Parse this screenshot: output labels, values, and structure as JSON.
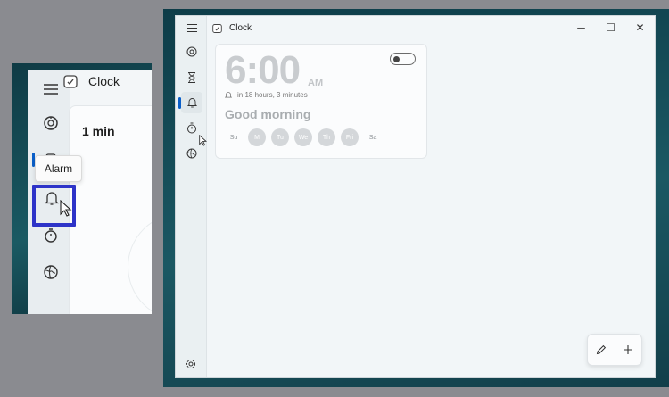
{
  "app": {
    "title": "Clock"
  },
  "inset": {
    "title": "Clock",
    "card_value": "1 min",
    "tooltip": "Alarm"
  },
  "window_controls": {
    "minimize": "─",
    "maximize": "☐",
    "close": "✕"
  },
  "nav": {
    "items": [
      {
        "id": "focus",
        "icon": "focus-sessions-icon"
      },
      {
        "id": "timer",
        "icon": "hourglass-icon"
      },
      {
        "id": "alarm",
        "icon": "bell-icon",
        "selected": true
      },
      {
        "id": "stopwatch",
        "icon": "stopwatch-icon"
      },
      {
        "id": "world",
        "icon": "globe-icon"
      }
    ],
    "settings_icon": "gear-icon"
  },
  "alarm": {
    "time": "6:00",
    "period": "AM",
    "next": "in 18 hours, 3 minutes",
    "name": "Good morning",
    "enabled": false,
    "days": [
      {
        "label": "Su",
        "on": false
      },
      {
        "label": "M",
        "on": true
      },
      {
        "label": "Tu",
        "on": true
      },
      {
        "label": "We",
        "on": true
      },
      {
        "label": "Th",
        "on": true
      },
      {
        "label": "Fri",
        "on": true
      },
      {
        "label": "Sa",
        "on": false
      }
    ]
  },
  "colors": {
    "accent": "#0a5fc9",
    "highlight": "#2d33c8"
  }
}
